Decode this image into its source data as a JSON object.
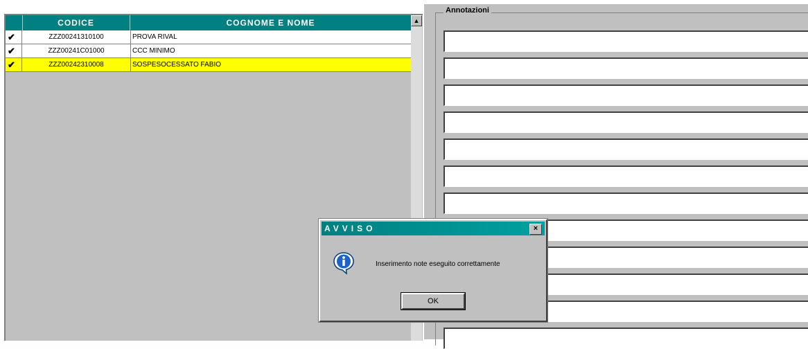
{
  "grid": {
    "headers": {
      "check": "",
      "code": "CODICE",
      "name": "COGNOME E NOME"
    },
    "rows": [
      {
        "check": "✔",
        "code": "ZZZ00241310100",
        "name": "PROVA RIVAL",
        "selected": false
      },
      {
        "check": "✔",
        "code": "ZZZ00241C01000",
        "name": "CCC MINIMO",
        "selected": false
      },
      {
        "check": "✔",
        "code": "ZZZ00242310008",
        "name": "SOSPESOCESSATO FABIO",
        "selected": true
      }
    ],
    "scroll_up_icon": "arrow-up-icon"
  },
  "notes": {
    "group_title": "Annotazioni",
    "field_count": 12
  },
  "dialog": {
    "title": "AVVISO",
    "close_label": "×",
    "message": "Inserimento note eseguito correttamente",
    "ok_label": "OK",
    "icon": "info-icon"
  },
  "colors": {
    "header_bg": "#008080",
    "selected_row": "#ffff00",
    "panel_bg": "#c0c0c0"
  }
}
